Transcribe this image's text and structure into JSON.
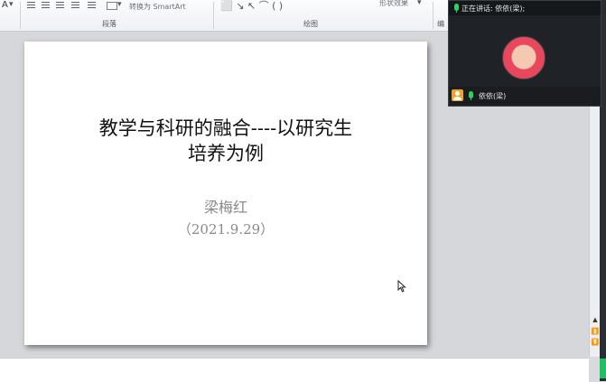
{
  "ribbon": {
    "group_paragraph_label": "段落",
    "group_drawing_label": "绘图",
    "smartart_label": "转换为 SmartArt",
    "shape_effects_label": "形状效果",
    "letter_a": "A",
    "cut_edge_char": "编"
  },
  "slide": {
    "title_line1": "教学与科研的融合----以研究生",
    "title_line2": "培养为例",
    "author": "梁梅红",
    "date": "（2021.9.29）"
  },
  "meeting": {
    "speaking_label": "正在讲话: 依依(梁);",
    "participant_name": "依依(梁)"
  },
  "icons": {
    "mic": "microphone-icon",
    "user": "user-icon",
    "cursor": "mouse-pointer-icon"
  },
  "colors": {
    "mic_green": "#2fd15f",
    "badge_orange": "#f0a32c",
    "avatar_red": "#e8475e"
  }
}
